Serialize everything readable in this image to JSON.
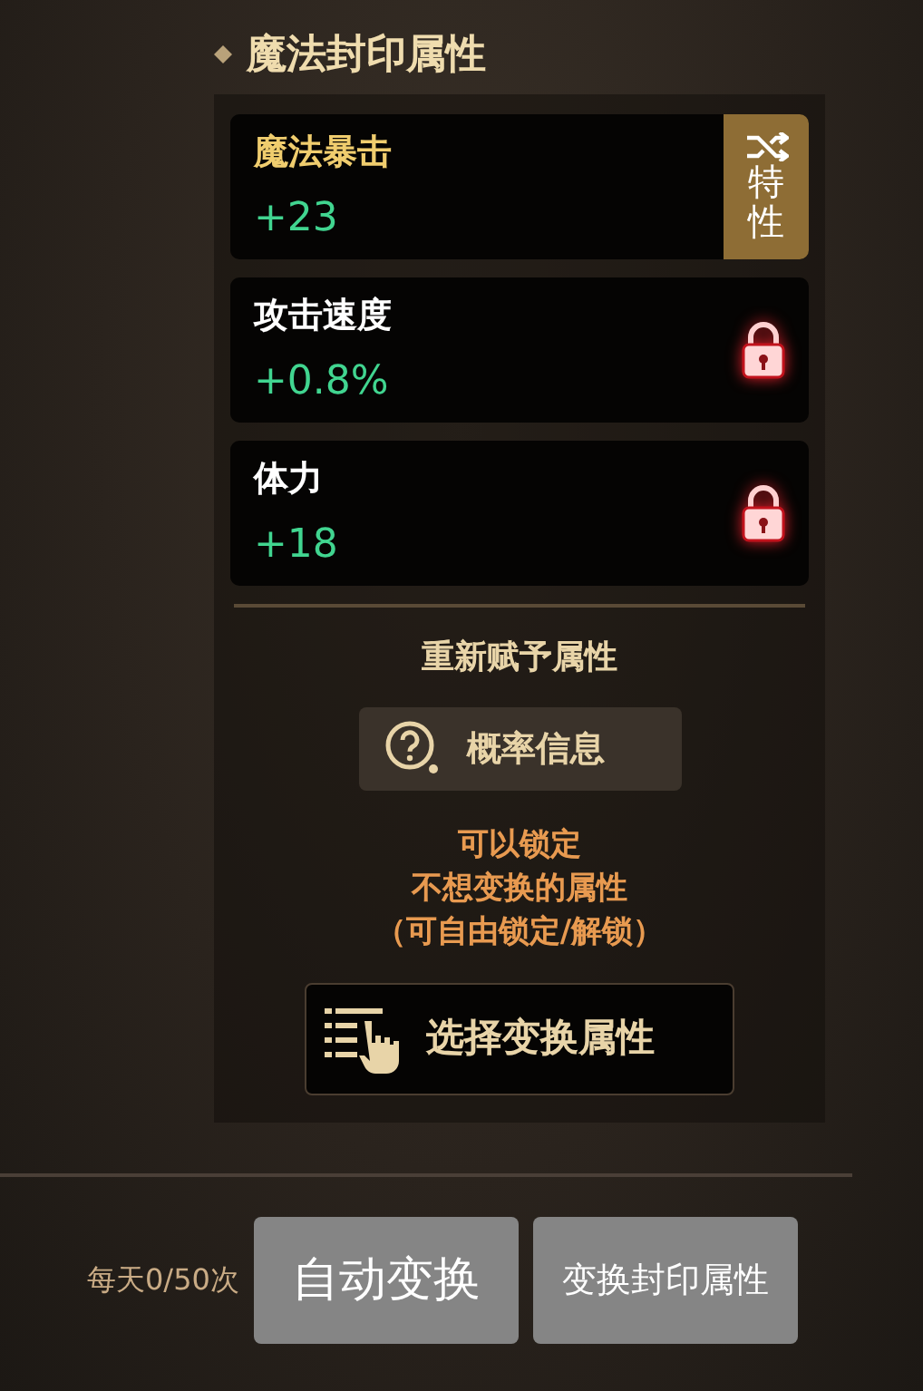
{
  "section_title": "魔法封印属性",
  "attributes": [
    {
      "kind": "trait",
      "name": "魔法暴击",
      "value": "+23",
      "badge": "特性"
    },
    {
      "kind": "normal",
      "name": "攻击速度",
      "value": "+0.8%",
      "locked": true
    },
    {
      "kind": "normal",
      "name": "体力",
      "value": "+18",
      "locked": true
    }
  ],
  "reroll_heading": "重新赋予属性",
  "probability_button": "概率信息",
  "lock_hint": [
    "可以锁定",
    "不想变换的属性",
    "（可自由锁定/解锁）"
  ],
  "select_button": "选择变换属性",
  "daily_count": "每天0/50次",
  "buttons": [
    "自动变换",
    "变换封印属性"
  ]
}
